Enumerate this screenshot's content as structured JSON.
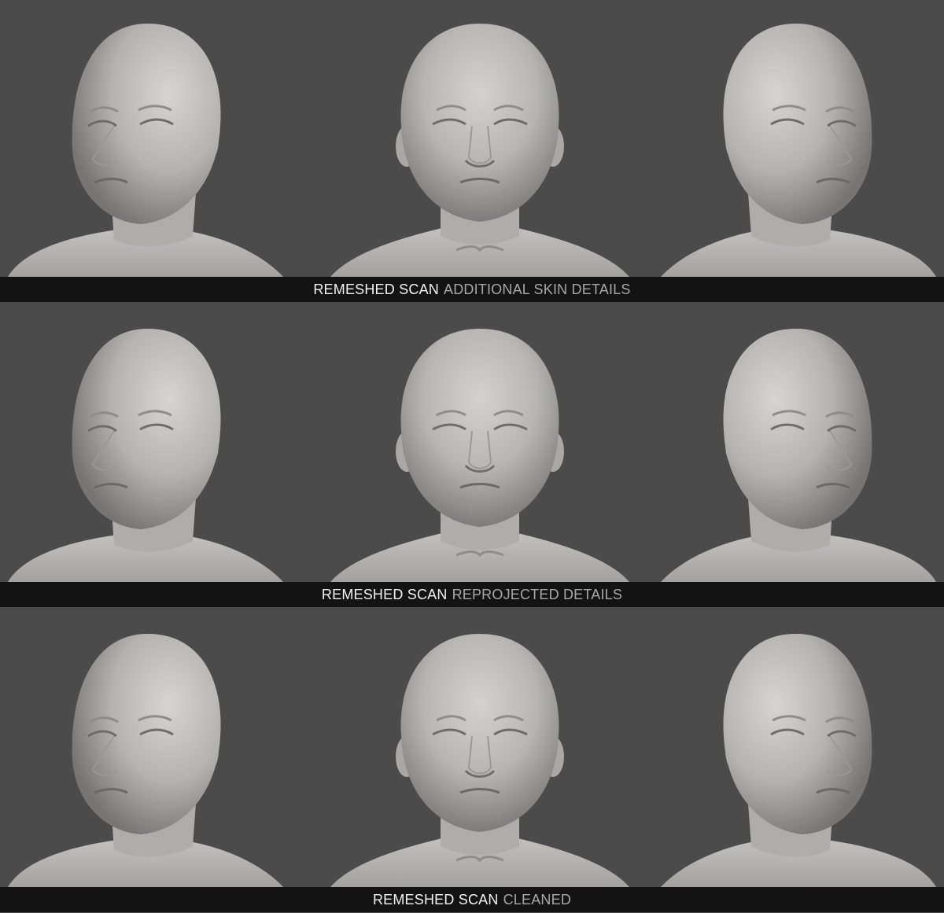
{
  "colors": {
    "background": "#4b4b4c",
    "caption_bar": "#131313",
    "caption_primary": "#f2f2f2",
    "caption_secondary": "#a8a8a8",
    "clay": "#b9b8b5"
  },
  "rows": [
    {
      "caption_primary": "REMESHED SCAN",
      "caption_secondary": "ADDITIONAL SKIN DETAILS",
      "views": [
        "three-quarter-left",
        "front",
        "three-quarter-right"
      ]
    },
    {
      "caption_primary": "REMESHED SCAN",
      "caption_secondary": "REPROJECTED DETAILS",
      "views": [
        "three-quarter-left",
        "front",
        "three-quarter-right"
      ]
    },
    {
      "caption_primary": "REMESHED SCAN",
      "caption_secondary": "CLEANED",
      "views": [
        "three-quarter-left",
        "front",
        "three-quarter-right"
      ]
    }
  ]
}
